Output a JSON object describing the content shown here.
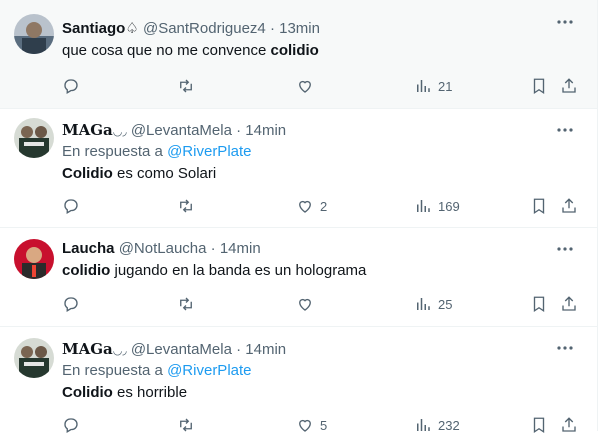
{
  "tweets": [
    {
      "name": "Santiago",
      "handle": "@SantRodriguez4",
      "time": "13min",
      "text_plain": "que cosa que no me convence ",
      "text_bold": "colidio",
      "text_after": "",
      "views": "21",
      "likes": "",
      "reply_prefix": "",
      "reply_mention": ""
    },
    {
      "name": "MAGa",
      "handle": "@LevantaMela",
      "time": "14min",
      "reply_prefix": "En respuesta a ",
      "reply_mention": "@RiverPlate",
      "text_bold": "Colidio",
      "text_after": " es como Solari",
      "likes": "2",
      "views": "169"
    },
    {
      "name": "Laucha",
      "handle": "@NotLaucha",
      "time": "14min",
      "text_bold": "colidio",
      "text_after": " jugando en la banda es un holograma",
      "likes": "",
      "views": "25"
    },
    {
      "name": "MAGa",
      "handle": "@LevantaMela",
      "time": "14min",
      "reply_prefix": "En respuesta a ",
      "reply_mention": "@RiverPlate",
      "text_bold": "Colidio",
      "text_after": " es horrible",
      "likes": "5",
      "views": "232"
    }
  ],
  "separator": " · ",
  "icons": [
    "reply-icon",
    "retweet-icon",
    "like-icon",
    "views-icon",
    "bookmark-icon",
    "share-icon",
    "more-icon"
  ],
  "colors": {
    "accent": "#1d9bf0",
    "muted": "#536471",
    "text": "#0f1419",
    "highlight_bg": "#f7f9f9"
  }
}
